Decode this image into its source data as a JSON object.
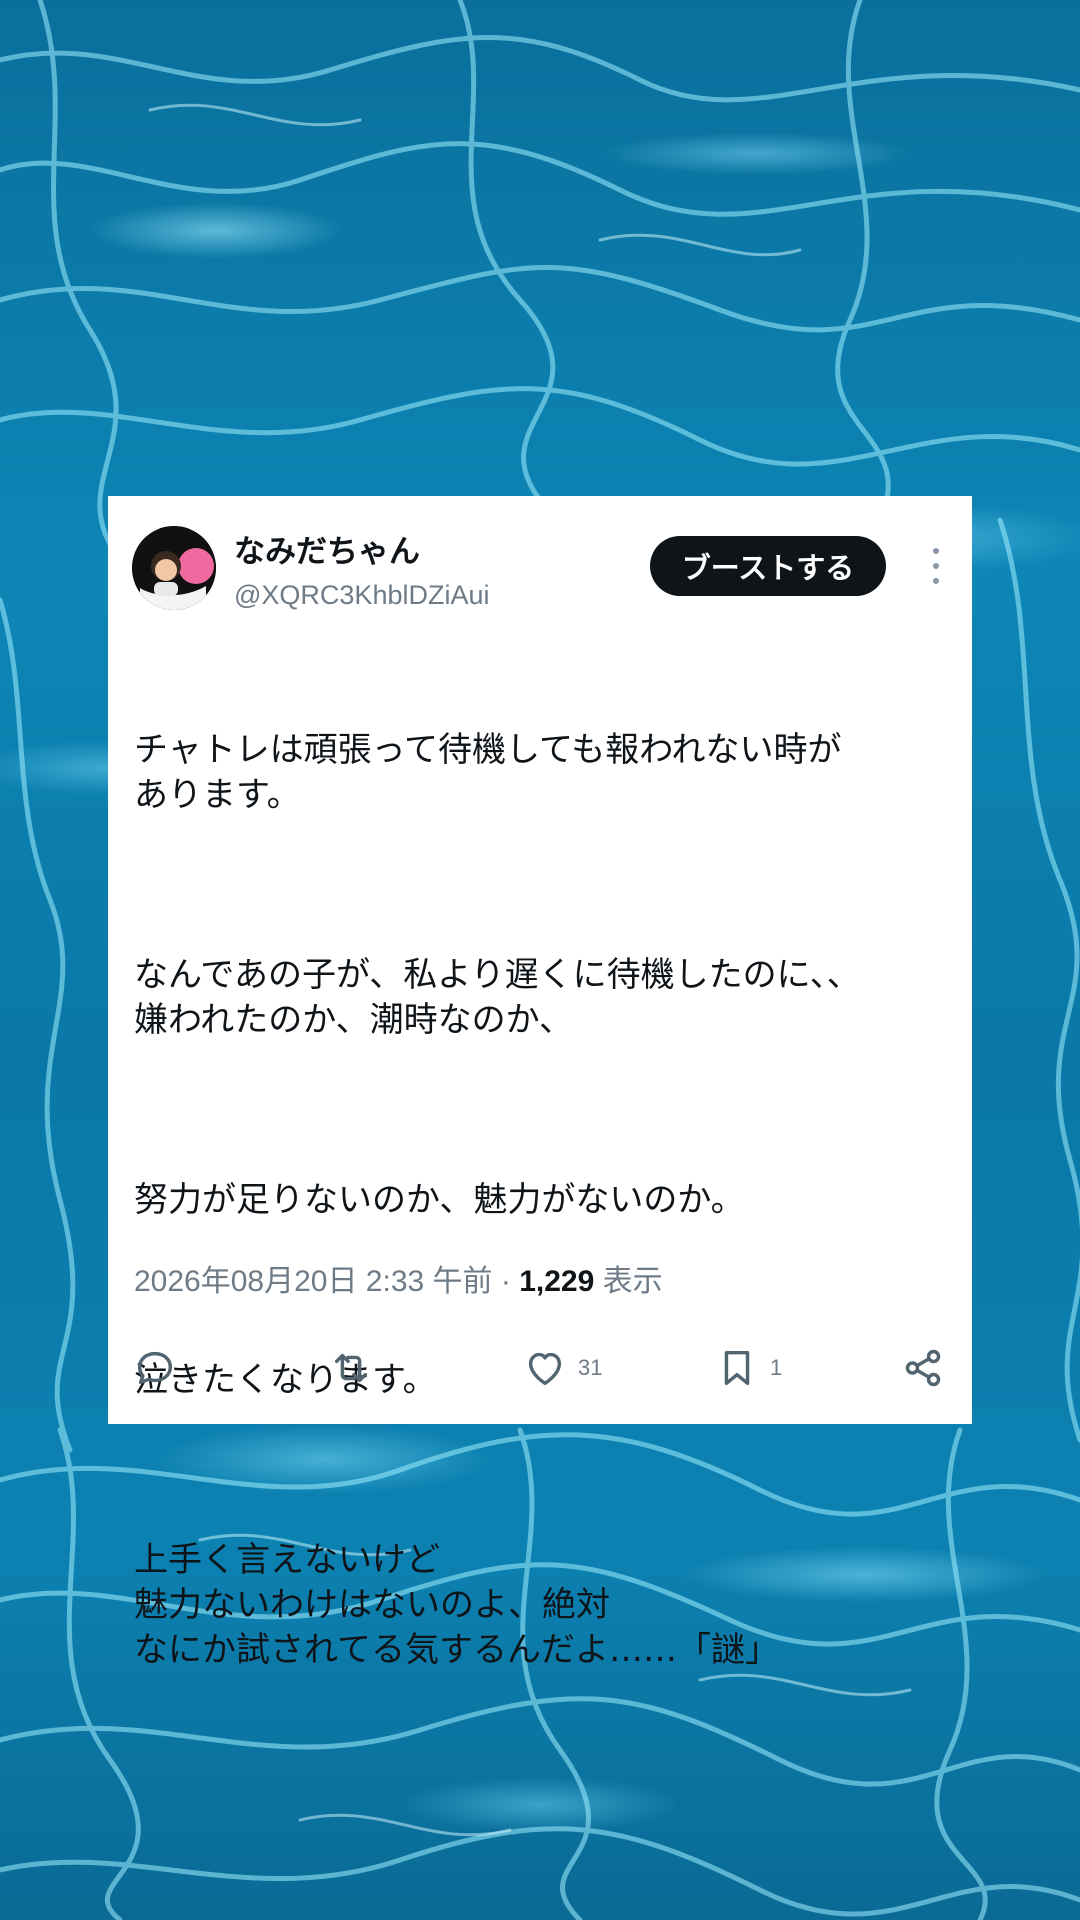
{
  "post": {
    "display_name": "なみだちゃん",
    "handle": "@XQRC3KhblDZiAui",
    "boost_label": "ブーストする",
    "paragraphs": [
      "チャトレは頑張って待機しても報われない時が\nあります。",
      "なんであの子が、私より遅くに待機したのに、、\n嫌われたのか、潮時なのか、",
      "努力が足りないのか、魅力がないのか。",
      "泣きたくなります。",
      "上手く言えないけど\n魅力ないわけはないのよ、絶対\nなにか試されてる気するんだよ……「謎」"
    ],
    "timestamp": "2026年08月20日 2:33 午前",
    "separator": " · ",
    "views_count": "1,229",
    "views_label": " 表示"
  },
  "actions": {
    "reply_icon": "reply-icon",
    "repost_icon": "repost-icon",
    "like_icon": "heart-icon",
    "like_count": "31",
    "bookmark_icon": "bookmark-icon",
    "bookmark_count": "1",
    "share_icon": "share-icon"
  },
  "colors": {
    "water": "#0c82b2",
    "text": "#0f1419",
    "muted": "#6e7b87",
    "button": "#0f1419"
  }
}
